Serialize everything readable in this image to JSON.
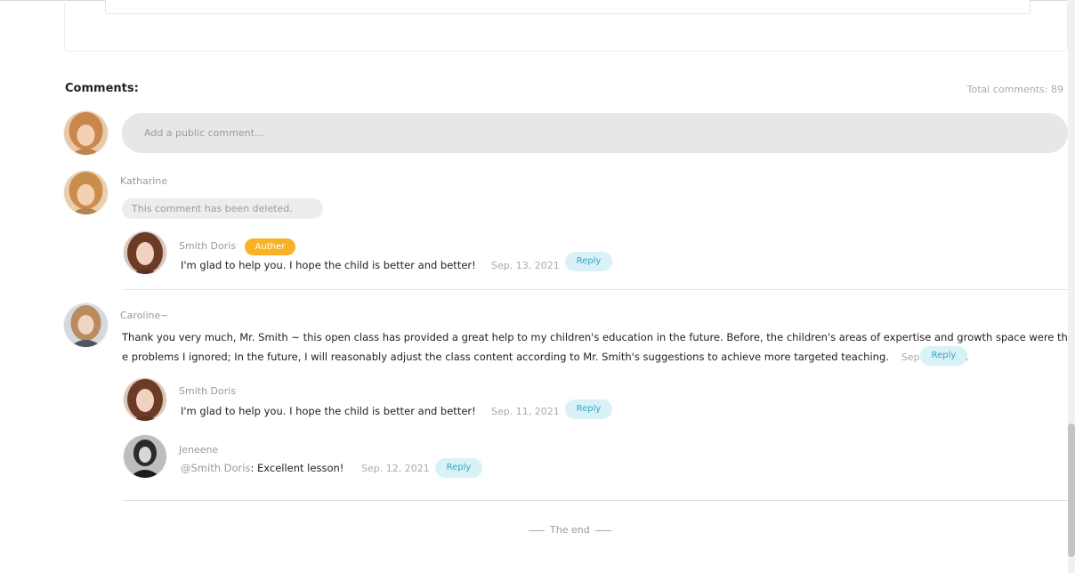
{
  "comments_section": {
    "heading": "Comments:",
    "total": "Total comments: 89",
    "input_placeholder": "Add a public comment...",
    "end_text": "The end"
  },
  "threads": [
    {
      "author": "Katharine",
      "deleted_text": "This comment has been deleted.",
      "replies": [
        {
          "author": "Smith Doris",
          "badge": "Auther",
          "text": "I'm glad to help you. I hope the child is better and better!",
          "date": "Sep. 13, 2021",
          "reply_label": "Reply"
        }
      ]
    },
    {
      "author": "Caroline~",
      "text": "Thank you very much, Mr. Smith ~ this open class has provided a great help to my children's education in the future. Before, the children's areas of expertise and growth space were the problems I ignored; In the future, I will reasonably adjust the class content according to Mr. Smith's suggestions to achieve more targeted teaching.",
      "date": "Sep. 11, 2021",
      "reply_label": "Reply",
      "replies": [
        {
          "author": "Smith Doris",
          "text": "I'm glad to help you. I hope the child is better and better!",
          "date": "Sep. 11, 2021",
          "reply_label": "Reply"
        },
        {
          "author": "Jeneene",
          "mention": "@Smith Doris",
          "text": ": Excellent lesson!",
          "date": "Sep. 12, 2021",
          "reply_label": "Reply"
        }
      ]
    }
  ],
  "colors": {
    "badge": "#f7b226",
    "reply_bg": "#d9f2f7",
    "reply_text": "#3aa3c0",
    "input_bg": "#e7e7e7"
  }
}
